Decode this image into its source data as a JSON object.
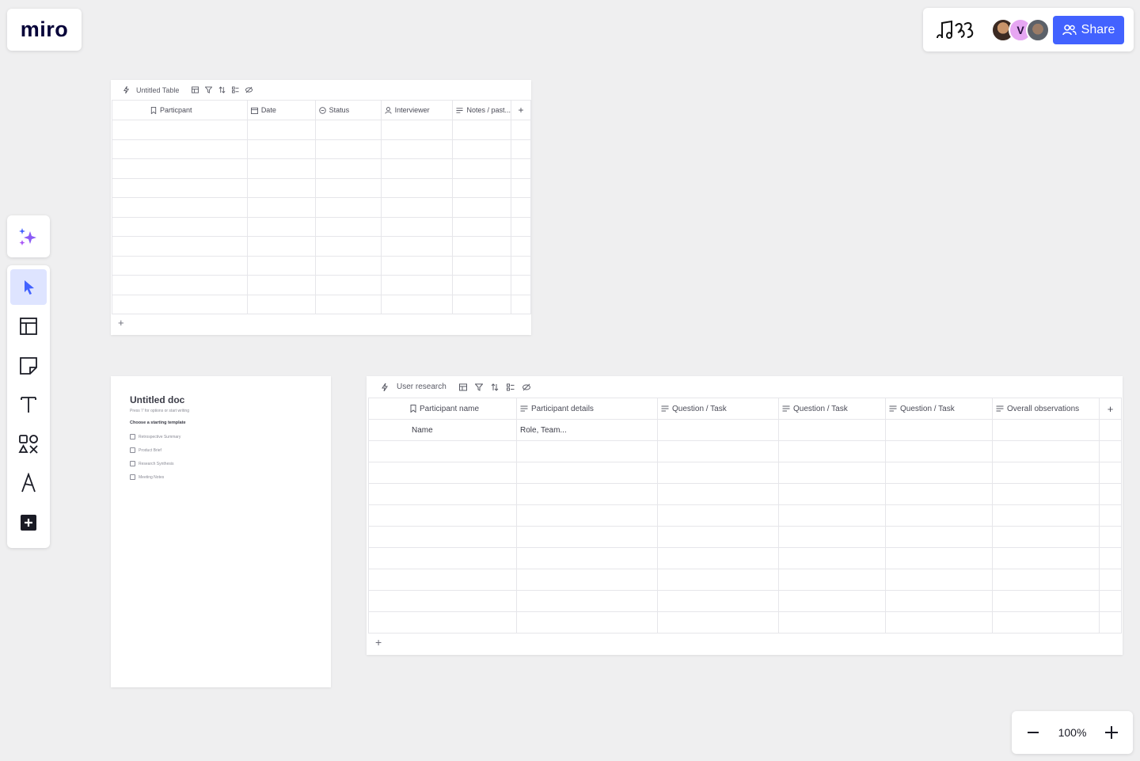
{
  "app": {
    "logo": "miro",
    "brand_color": "#050038",
    "accent_color": "#4262ff"
  },
  "header": {
    "board_icon": "board-doodle-icon",
    "collaborators": [
      {
        "initial": "",
        "icon": "avatar-photo"
      },
      {
        "initial": "V",
        "icon": "avatar-initial"
      },
      {
        "initial": "",
        "icon": "avatar-photo"
      }
    ],
    "share_label": "Share",
    "share_icon": "users-icon"
  },
  "toolbar": {
    "ai_icon": "sparkles-icon",
    "tools": [
      {
        "name": "select",
        "icon": "cursor-icon",
        "active": true
      },
      {
        "name": "templates",
        "icon": "layout-icon",
        "active": false
      },
      {
        "name": "sticky-note",
        "icon": "sticky-note-icon",
        "active": false
      },
      {
        "name": "text",
        "icon": "text-icon",
        "active": false
      },
      {
        "name": "shapes",
        "icon": "shapes-icon",
        "active": false
      },
      {
        "name": "pen",
        "icon": "pen-icon",
        "active": false
      },
      {
        "name": "more",
        "icon": "plus-box-icon",
        "active": false
      }
    ]
  },
  "table1": {
    "title": "Untitled Table",
    "columns": [
      {
        "label": "Particpant",
        "icon": "bookmark-icon"
      },
      {
        "label": "Date",
        "icon": "calendar-icon"
      },
      {
        "label": "Status",
        "icon": "status-icon"
      },
      {
        "label": "Interviewer",
        "icon": "person-icon"
      },
      {
        "label": "Notes / past...",
        "icon": "text-lines-icon"
      }
    ],
    "row_count": 10,
    "add_row": "+",
    "add_column": "+"
  },
  "doc": {
    "title": "Untitled doc",
    "hint": "Press '/' for options or start writing",
    "subtitle": "Choose a starting template",
    "templates": [
      "Retrospective Summary",
      "Product Brief",
      "Research Synthesis",
      "Meeting Notes"
    ]
  },
  "table2": {
    "title": "User research",
    "columns": [
      {
        "label": "Participant name",
        "icon": "bookmark-icon"
      },
      {
        "label": "Participant details",
        "icon": "text-lines-icon"
      },
      {
        "label": "Question / Task",
        "icon": "text-lines-icon"
      },
      {
        "label": "Question / Task",
        "icon": "text-lines-icon"
      },
      {
        "label": "Question / Task",
        "icon": "text-lines-icon"
      },
      {
        "label": "Overall observations",
        "icon": "text-lines-icon"
      }
    ],
    "rows": [
      [
        "Name",
        "Role, Team...",
        "",
        "",
        "",
        ""
      ],
      [
        "",
        "",
        "",
        "",
        "",
        ""
      ],
      [
        "",
        "",
        "",
        "",
        "",
        ""
      ],
      [
        "",
        "",
        "",
        "",
        "",
        ""
      ],
      [
        "",
        "",
        "",
        "",
        "",
        ""
      ],
      [
        "",
        "",
        "",
        "",
        "",
        ""
      ],
      [
        "",
        "",
        "",
        "",
        "",
        ""
      ],
      [
        "",
        "",
        "",
        "",
        "",
        ""
      ],
      [
        "",
        "",
        "",
        "",
        "",
        ""
      ],
      [
        "",
        "",
        "",
        "",
        "",
        ""
      ]
    ],
    "add_row": "+",
    "add_column": "+"
  },
  "zoom": {
    "level": "100%",
    "minus": "−",
    "plus": "+"
  }
}
